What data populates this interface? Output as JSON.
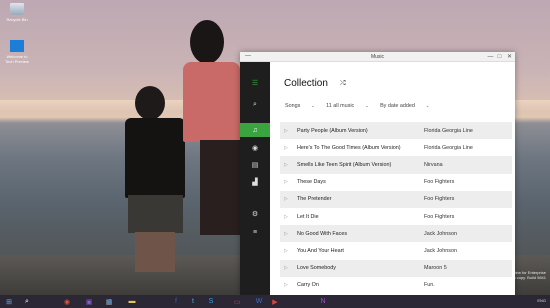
{
  "desktop": {
    "icons": [
      {
        "label": "Recycle Bin",
        "icon": "recycle-bin-icon"
      },
      {
        "label": "Welcome to Tech Preview",
        "icon": "windows-welcome-icon"
      }
    ],
    "watermark": {
      "line1": "Windows 10 Pro Technical Preview for Enterprise",
      "line2": "Evaluation copy. Build 9841"
    }
  },
  "window": {
    "title": "Music",
    "controls": {
      "minimize": "—",
      "maximize": "□",
      "close": "✕"
    },
    "sidebar": [
      {
        "name": "menu-icon",
        "glyph": "☰"
      },
      {
        "name": "search-icon",
        "glyph": "⌕"
      },
      {
        "name": "music-note-icon",
        "glyph": "♫",
        "active": true
      },
      {
        "name": "radio-icon",
        "glyph": "◉"
      },
      {
        "name": "playlist-icon",
        "glyph": "▤"
      },
      {
        "name": "chart-icon",
        "glyph": "▟"
      },
      {
        "name": "settings-icon",
        "glyph": "⚙"
      },
      {
        "name": "queue-icon",
        "glyph": "≡"
      }
    ],
    "heading": "Collection",
    "shuffle_icon": "⤮",
    "filters": {
      "view": "Songs",
      "source": "11 all music",
      "sort": "By date added"
    },
    "tracks": [
      {
        "title": "Party People (Album Version)",
        "artist": "Florida Georgia Line"
      },
      {
        "title": "Here's To The Good Times (Album Version)",
        "artist": "Florida Georgia Line"
      },
      {
        "title": "Smells Like Teen Spirit (Album Version)",
        "artist": "Nirvana"
      },
      {
        "title": "These Days",
        "artist": "Foo Fighters"
      },
      {
        "title": "The Pretender",
        "artist": "Foo Fighters"
      },
      {
        "title": "Let It Die",
        "artist": "Foo Fighters"
      },
      {
        "title": "No Good With Faces",
        "artist": "Jack Johnson"
      },
      {
        "title": "You And Your Heart",
        "artist": "Jack Johnson"
      },
      {
        "title": "Love Somebody",
        "artist": "Maroon 5"
      },
      {
        "title": "Carry On",
        "artist": "Fun."
      }
    ]
  },
  "taskbar": {
    "start_glyph": "⊞",
    "search_glyph": "⌕",
    "apps": [
      "◉",
      "▣",
      "▦",
      "e",
      "▬",
      "f",
      "t",
      "S",
      "▭",
      "W",
      "▶",
      "N"
    ],
    "tray_text": "ENG"
  },
  "colors": {
    "accent": "#3aa43f",
    "sidebar": "#1e1e1e",
    "taskbar": "#2b2734"
  }
}
